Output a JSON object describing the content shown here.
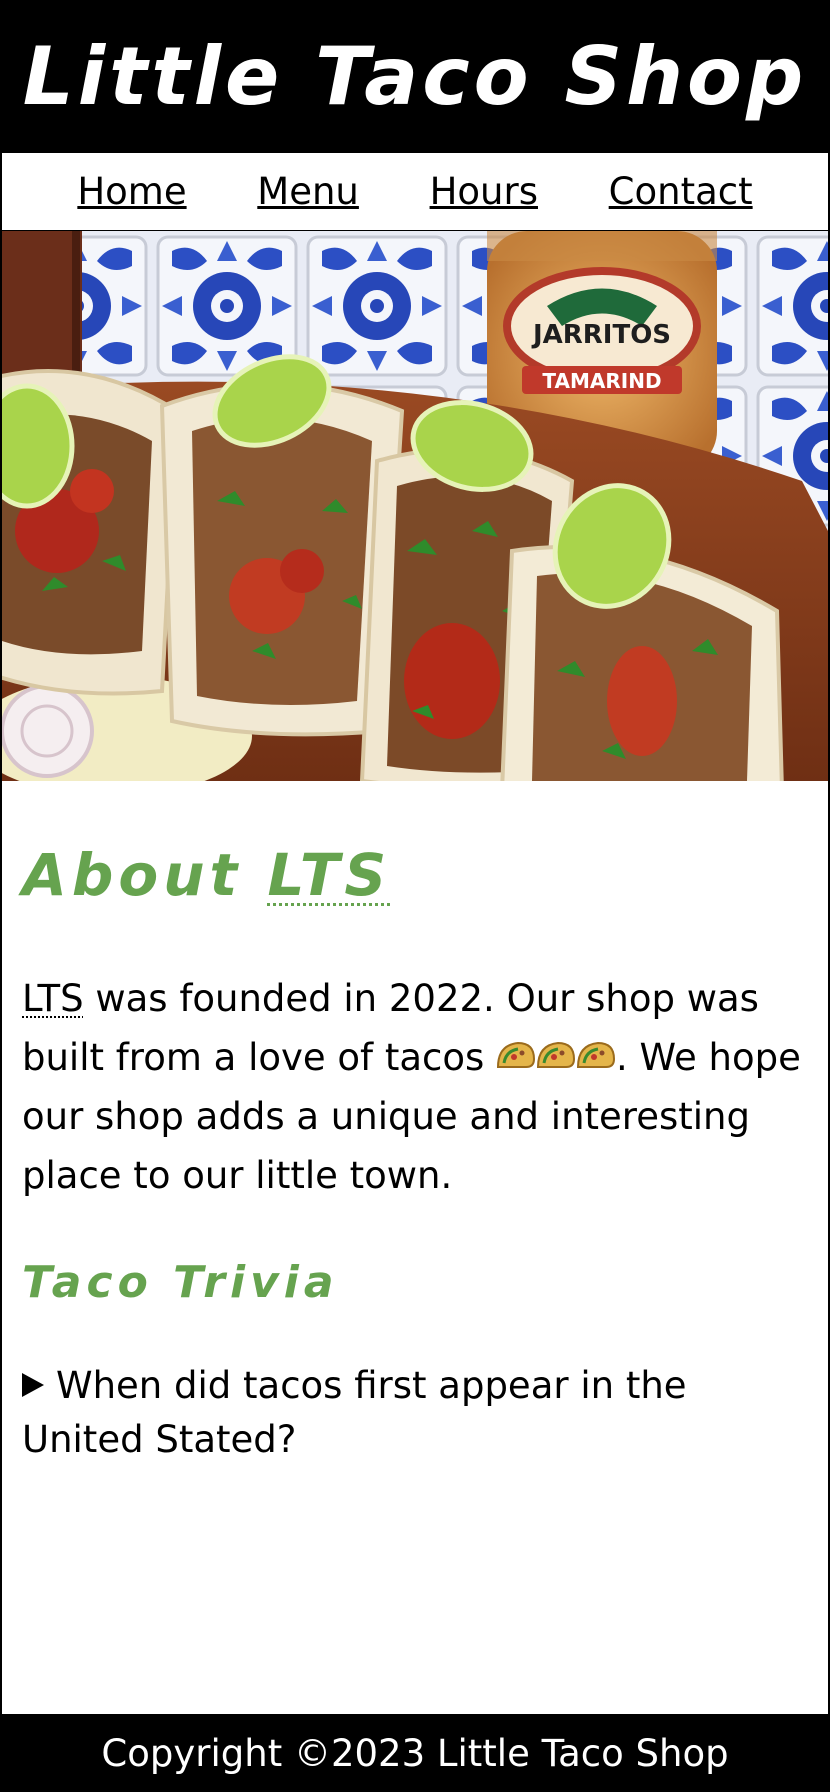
{
  "header": {
    "title": "Little Taco Shop"
  },
  "nav": {
    "items": [
      {
        "label": "Home"
      },
      {
        "label": "Menu"
      },
      {
        "label": "Hours"
      },
      {
        "label": "Contact"
      }
    ]
  },
  "hero": {
    "bottle_brand": "JARRITOS",
    "bottle_flavor": "TAMARIND"
  },
  "about": {
    "heading_prefix": "About ",
    "heading_abbr": "LTS",
    "text_abbr": "LTS",
    "text_part1": " was founded in 2022. Our shop was built from a love of tacos ",
    "text_part2": ". We hope our shop adds a unique and interesting place to our little town.",
    "emoji": "taco-emoji"
  },
  "trivia": {
    "heading": "Taco Trivia",
    "question": "When did tacos first appear in the United Stated?"
  },
  "footer": {
    "copyright": "Copyright ©2023 Little Taco Shop"
  },
  "colors": {
    "accent": "#66a34f",
    "header_bg": "#000000",
    "footer_bg": "#000000"
  }
}
